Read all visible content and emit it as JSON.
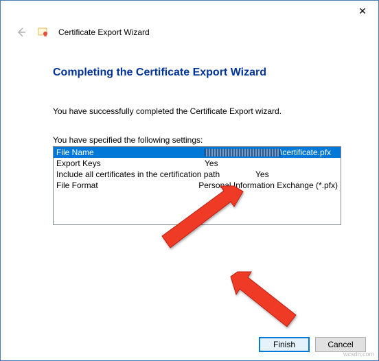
{
  "window": {
    "title": "Certificate Export Wizard",
    "close_label": "✕"
  },
  "content": {
    "heading": "Completing the Certificate Export Wizard",
    "success_text": "You have successfully completed the Certificate Export wizard.",
    "settings_label": "You have specified the following settings:",
    "rows": [
      {
        "key": "File Name",
        "val_suffix": "\\certificate.pfx",
        "redacted": true,
        "selected": true
      },
      {
        "key": "Export Keys",
        "val": "Yes"
      },
      {
        "key": "Include all certificates in the certification path",
        "val": "Yes"
      },
      {
        "key": "File Format",
        "val": "Personal Information Exchange (*.pfx)"
      }
    ]
  },
  "footer": {
    "finish": "Finish",
    "cancel": "Cancel"
  },
  "watermark": "wcsdn.com",
  "colors": {
    "selection": "#0078d7",
    "heading": "#003399",
    "arrow": "#ef3a27"
  }
}
